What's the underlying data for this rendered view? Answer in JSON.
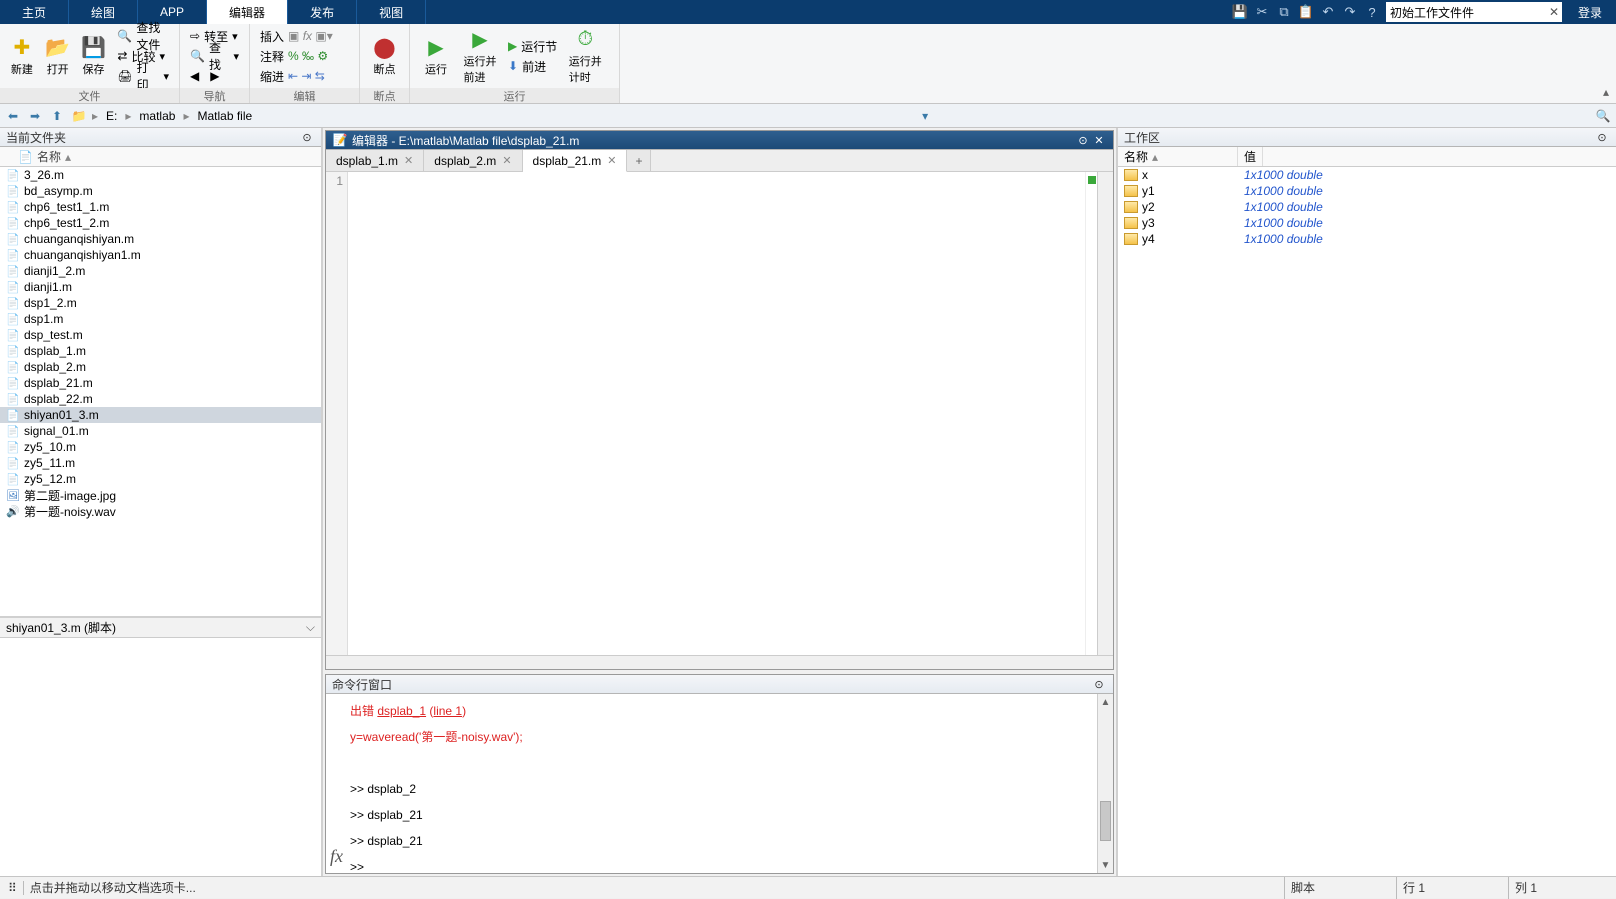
{
  "tabs": [
    "主页",
    "绘图",
    "APP",
    "编辑器",
    "发布",
    "视图"
  ],
  "active_tab": 3,
  "search_placeholder": "初始工作文件件",
  "login": "登录",
  "ribbon": {
    "groups": {
      "file": {
        "label": "文件",
        "new": "新建",
        "open": "打开",
        "save": "保存",
        "find": "查找文件",
        "compare": "比较",
        "print": "打印"
      },
      "nav": {
        "label": "导航",
        "goto": "转至",
        "find": "查找",
        "back": "◀",
        "fwd": "▶"
      },
      "edit": {
        "label": "编辑",
        "insert": "插入",
        "comment": "注释",
        "indent": "缩进",
        "fx": "fx"
      },
      "break": {
        "label": "断点",
        "break": "断点"
      },
      "run": {
        "label": "运行",
        "run": "运行",
        "run_advance": "运行并\n前进",
        "run_section": "运行节",
        "advance": "前进",
        "run_time": "运行并\n计时"
      }
    }
  },
  "path": {
    "drive": "E:",
    "seg1": "matlab",
    "seg2": "Matlab file"
  },
  "current_folder": {
    "title": "当前文件夹",
    "col": "名称",
    "files": [
      {
        "n": "3_26.m",
        "t": "m"
      },
      {
        "n": "bd_asymp.m",
        "t": "m"
      },
      {
        "n": "chp6_test1_1.m",
        "t": "m"
      },
      {
        "n": "chp6_test1_2.m",
        "t": "m"
      },
      {
        "n": "chuanganqishiyan.m",
        "t": "m"
      },
      {
        "n": "chuanganqishiyan1.m",
        "t": "m"
      },
      {
        "n": "dianji1_2.m",
        "t": "m"
      },
      {
        "n": "dianji1.m",
        "t": "m"
      },
      {
        "n": "dsp1_2.m",
        "t": "m"
      },
      {
        "n": "dsp1.m",
        "t": "m"
      },
      {
        "n": "dsp_test.m",
        "t": "m"
      },
      {
        "n": "dsplab_1.m",
        "t": "m"
      },
      {
        "n": "dsplab_2.m",
        "t": "m"
      },
      {
        "n": "dsplab_21.m",
        "t": "m"
      },
      {
        "n": "dsplab_22.m",
        "t": "m"
      },
      {
        "n": "shiyan01_3.m",
        "t": "m",
        "sel": true
      },
      {
        "n": "signal_01.m",
        "t": "m"
      },
      {
        "n": "zy5_10.m",
        "t": "m"
      },
      {
        "n": "zy5_11.m",
        "t": "m"
      },
      {
        "n": "zy5_12.m",
        "t": "m"
      },
      {
        "n": "第二题-image.jpg",
        "t": "img"
      },
      {
        "n": "第一题-noisy.wav",
        "t": "wav"
      }
    ]
  },
  "detail": "shiyan01_3.m  (脚本)",
  "editor": {
    "title": "编辑器 - E:\\matlab\\Matlab file\\dsplab_21.m",
    "tabs": [
      {
        "label": "dsplab_1.m"
      },
      {
        "label": "dsplab_2.m"
      },
      {
        "label": "dsplab_21.m",
        "active": true
      }
    ],
    "line": "1"
  },
  "cmd": {
    "title": "命令行窗口",
    "lines": [
      {
        "t": "err",
        "pre": "出错 ",
        "l1": "dsplab_1",
        "mid": " (",
        "l2": "line 1",
        "post": ")"
      },
      {
        "t": "err",
        "text": "y=waveread('第一题-noisy.wav');"
      },
      {
        "t": "blank"
      },
      {
        "t": "norm",
        "text": ">> dsplab_2"
      },
      {
        "t": "norm",
        "text": ">> dsplab_21"
      },
      {
        "t": "norm",
        "text": ">> dsplab_21"
      },
      {
        "t": "norm",
        "text": ">> "
      }
    ]
  },
  "workspace": {
    "title": "工作区",
    "col_name": "名称",
    "col_val": "值",
    "vars": [
      {
        "n": "x",
        "v": "1x1000 double"
      },
      {
        "n": "y1",
        "v": "1x1000 double"
      },
      {
        "n": "y2",
        "v": "1x1000 double"
      },
      {
        "n": "y3",
        "v": "1x1000 double"
      },
      {
        "n": "y4",
        "v": "1x1000 double"
      }
    ]
  },
  "status": {
    "msg": "点击并拖动以移动文档选项卡...",
    "script": "脚本",
    "row": "行",
    "row_v": "1",
    "col": "列",
    "col_v": "1"
  }
}
